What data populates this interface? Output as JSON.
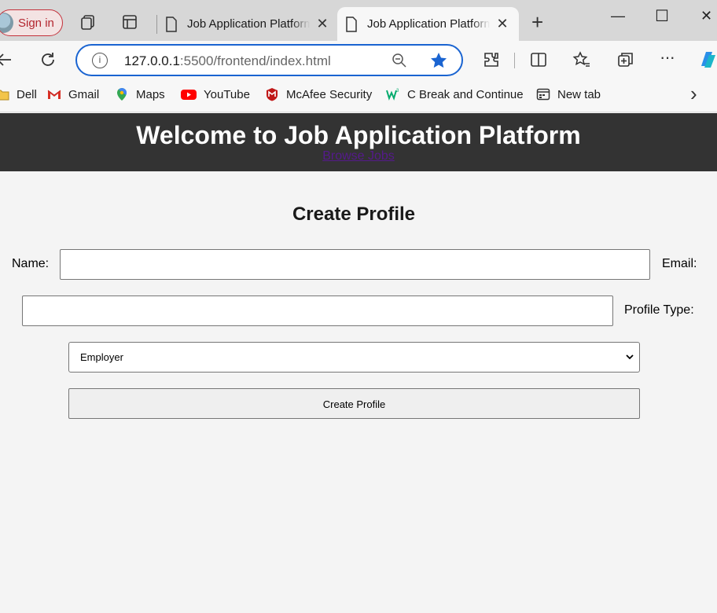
{
  "browser": {
    "signin_label": "Sign in",
    "tabs": [
      {
        "title": "Job Application Platform",
        "close": "✕"
      },
      {
        "title": "Job Application Platform",
        "close": "✕"
      }
    ],
    "new_tab": "+",
    "window": {
      "minimize": "—",
      "maximize": "☐",
      "close": "✕"
    },
    "address": {
      "host": "127.0.0.1",
      "rest": ":5500/frontend/index.html",
      "info": "i"
    },
    "more_menu": "···",
    "bookmarks": [
      {
        "label": "Dell",
        "icon": "folder-icon"
      },
      {
        "label": "Gmail",
        "icon": "gmail-icon"
      },
      {
        "label": "Maps",
        "icon": "maps-icon"
      },
      {
        "label": "YouTube",
        "icon": "youtube-icon"
      },
      {
        "label": "McAfee Security",
        "icon": "mcafee-icon"
      },
      {
        "label": "C Break and Continue",
        "icon": "w3schools-icon"
      },
      {
        "label": "New tab",
        "icon": "newtab-icon"
      }
    ],
    "bookmarks_more": "›",
    "accent": "#1a64d1"
  },
  "page": {
    "header_title": "Welcome to Job Application Platform",
    "browse_link": "Browse Jobs",
    "header_bg": "#333333",
    "form": {
      "title": "Create Profile",
      "name_label": "Name:",
      "name_value": "",
      "email_label": "Email:",
      "email_value": "",
      "profile_type_label": "Profile Type:",
      "profile_type_selected": "Employer",
      "submit_label": "Create Profile"
    }
  }
}
